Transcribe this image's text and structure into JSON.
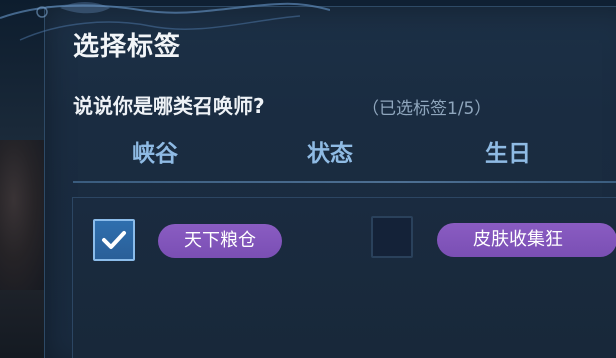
{
  "dialog": {
    "title": "选择标签",
    "question": "说说你是哪类召唤师?",
    "counter": "（已选标签1/5）"
  },
  "tabs": [
    {
      "label": "峡谷"
    },
    {
      "label": "状态"
    },
    {
      "label": "生日"
    }
  ],
  "tags": [
    {
      "label": "天下粮仓",
      "checked": true
    },
    {
      "label": "皮肤收集狂",
      "checked": false
    }
  ],
  "colors": {
    "accent_tab": "#8fbbe4",
    "tag_pill": "#8a5cc2",
    "checkbox_checked": "#2f6fae",
    "panel": "#1a2c41"
  },
  "icons": {
    "check": "check-icon"
  }
}
